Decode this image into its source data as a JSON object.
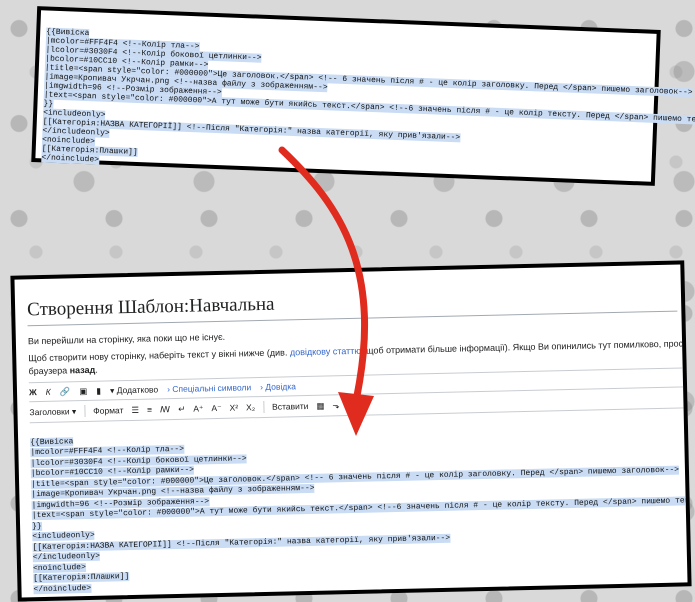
{
  "top_code": [
    "{{Вивіска",
    "|mcolor=#FFF4F4 <!--Колір тла-->",
    "|lcolor=#3030F4 <!--Колір бокової цетлинки-->",
    "|bcolor=#10CC10 <!--Колір рамки-->",
    "|title=<span style=\"color: #000000\">Це заголовок.</span> <!-- 6 значень після # - це колір заголовку. Перед </span> пишемо заголовок-->",
    "|image=Кропивач Укрчан.png <!--назва файлу з зображенням-->",
    "|imgwidth=96 <!--Розмір зображення-->",
    "|text=<span style=\"color: #000000\">А тут може бути якийсь текст.</span> <!--6 значень після # - це колір тексту. Перед </span> пишемо текст-->",
    "}}",
    "<includeonly>",
    "[[Категорія:НАЗВА КАТЕГОРІЇ]] <!--Після \"Категорія:\" назва категорії, яку прив'язали-->",
    "</includeonly>",
    "<noinclude>",
    "[[Категорія:Плашки]]",
    "</noinclude>"
  ],
  "editor": {
    "title": "Створення Шаблон:Навчальна",
    "info1": "Ви перейшли на сторінку, яка поки що не існує.",
    "info2_pre": "Щоб створити нову сторінку, наберіть текст у вікні нижче (див. ",
    "info2_link": "довідкову статтю",
    "info2_post": ", щоб отримати більше інформації). Якщо Ви опинились тут помилково, просто натисніть кн",
    "info3_pre": "браузера ",
    "info3_bold": "назад",
    "info3_post": ".",
    "toolbar1": {
      "bold": "Ж",
      "italic": "К",
      "advanced": "Додатково",
      "special": "Спеціальні символи",
      "help": "Довідка"
    },
    "toolbar2": {
      "headings": "Заголовки",
      "format": "Формат",
      "insert": "Вставити"
    },
    "code": [
      "{{Вивіска",
      "|mcolor=#FFF4F4 <!--Колір тла-->",
      "|lcolor=#3030F4 <!--Колір бокової цетлинки-->",
      "|bcolor=#10CC10 <!--Колір рамки-->",
      "|title=<span style=\"color: #000000\">Це заголовок.</span> <!-- 6 значень після # - це колір заголовку. Перед </span> пишемо заголовок-->",
      "|image=Кропивач Укрчан.png <!--назва файлу з зображенням-->",
      "|imgwidth=96 <!--Розмір зображення-->",
      "|text=<span style=\"color: #000000\">А тут може бути якийсь текст.</span> <!--6 значень після # - це колір тексту. Перед </span> пишемо текст-->",
      "}}",
      "<includeonly>",
      "[[Категорія:НАЗВА КАТЕГОРІЇ]] <!--Після \"Категорія:\" назва категорії, яку прив'язали-->",
      "</includeonly>",
      "<noinclude>",
      "[[Категорія:Плашки]]",
      "</noinclude>"
    ]
  },
  "colors": {
    "highlight": "#c9dcf4",
    "arrow": "#e02b1f",
    "link": "#3366cc"
  }
}
